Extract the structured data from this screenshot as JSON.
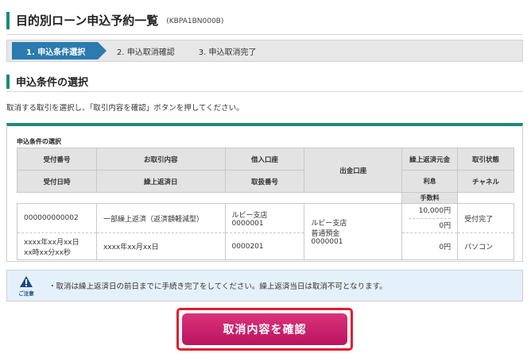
{
  "header": {
    "title": "目的別ローン申込予約一覧",
    "code": "(KBPA1BN000B)"
  },
  "steps": [
    "1. 申込条件選択",
    "2. 申込取消確認",
    "3. 申込取消完了"
  ],
  "section": {
    "title": "申込条件の選択",
    "instruction": "取消する取引を選択し、「取引内容を確認」ボタンを押してください。"
  },
  "table": {
    "caption": "申込条件の選択",
    "headers": {
      "reception_no": "受付番号",
      "deal_content": "お取引内容",
      "borrow_account": "借入口座",
      "withdraw_account": "出金口座",
      "repay_principal": "繰上返済元金",
      "status": "取引状態",
      "reception_date": "受付日時",
      "repay_date": "繰上返済日",
      "handling_no": "取扱番号",
      "interest": "利息",
      "fee": "手数料",
      "channel": "チャネル"
    },
    "row": {
      "reception_no": "000000000002",
      "deal_content": "一部繰上返済（返済額軽減型）",
      "borrow_branch": "ルビー支店",
      "borrow_number": "0000001",
      "withdraw_branch": "ルビー支店",
      "withdraw_type": "普通預金",
      "withdraw_number": "0000001",
      "principal": "10,000円",
      "interest": "0円",
      "fee": "0円",
      "status": "受付完了",
      "reception_date": "xxxx年xx月xx日",
      "reception_time": "xx時xx分xx秒",
      "repay_date": "xxxx年xx月xx日",
      "handling_no": "0000201",
      "channel": "パソコン"
    }
  },
  "notice": {
    "label": "ご注意",
    "text": "・取消は繰上返済日の前日までに手続き完了をしてください。繰上返済当日は取消不可となります。"
  },
  "action": {
    "confirm_label": "取消内容を確認"
  },
  "colors": {
    "accent": "#1e8a79",
    "step_active": "#2b7bb0",
    "button": "#c81c69",
    "highlight": "#e41b2c"
  }
}
